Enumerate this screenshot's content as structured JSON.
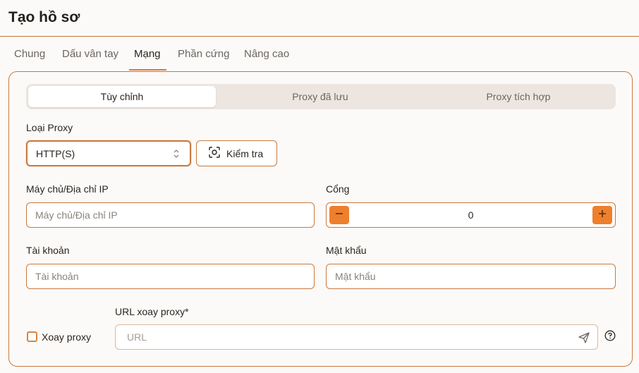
{
  "title": "Tạo hồ sơ",
  "tabs": [
    {
      "label": "Chung",
      "active": false
    },
    {
      "label": "Dấu vân tay",
      "active": false
    },
    {
      "label": "Mạng",
      "active": true
    },
    {
      "label": "Phần cứng",
      "active": false
    },
    {
      "label": "Nâng cao",
      "active": false
    }
  ],
  "proxy_source": {
    "options": [
      "Tùy chỉnh",
      "Proxy đã lưu",
      "Proxy tích hợp"
    ],
    "selected": "Tùy chỉnh"
  },
  "proxy_type": {
    "label": "Loại Proxy",
    "value": "HTTP(S)",
    "check_button": "Kiểm tra"
  },
  "host": {
    "label": "Máy chủ/Địa chỉ IP",
    "placeholder": "Máy chủ/Địa chỉ IP",
    "value": ""
  },
  "port": {
    "label": "Cổng",
    "value": "0"
  },
  "account": {
    "label": "Tài khoản",
    "placeholder": "Tài khoản",
    "value": ""
  },
  "password": {
    "label": "Mật khẩu",
    "placeholder": "Mật khẩu",
    "value": ""
  },
  "rotate": {
    "checkbox_label": "Xoay proxy",
    "checked": false,
    "url_label": "URL xoay proxy*",
    "url_placeholder": "URL"
  },
  "colors": {
    "accent": "#ee7f2d",
    "border": "#c9793f",
    "background": "#fcfaf8"
  },
  "icons": [
    "scan-icon",
    "chevron-updown-icon",
    "minus-icon",
    "plus-icon",
    "send-icon",
    "help-icon"
  ]
}
